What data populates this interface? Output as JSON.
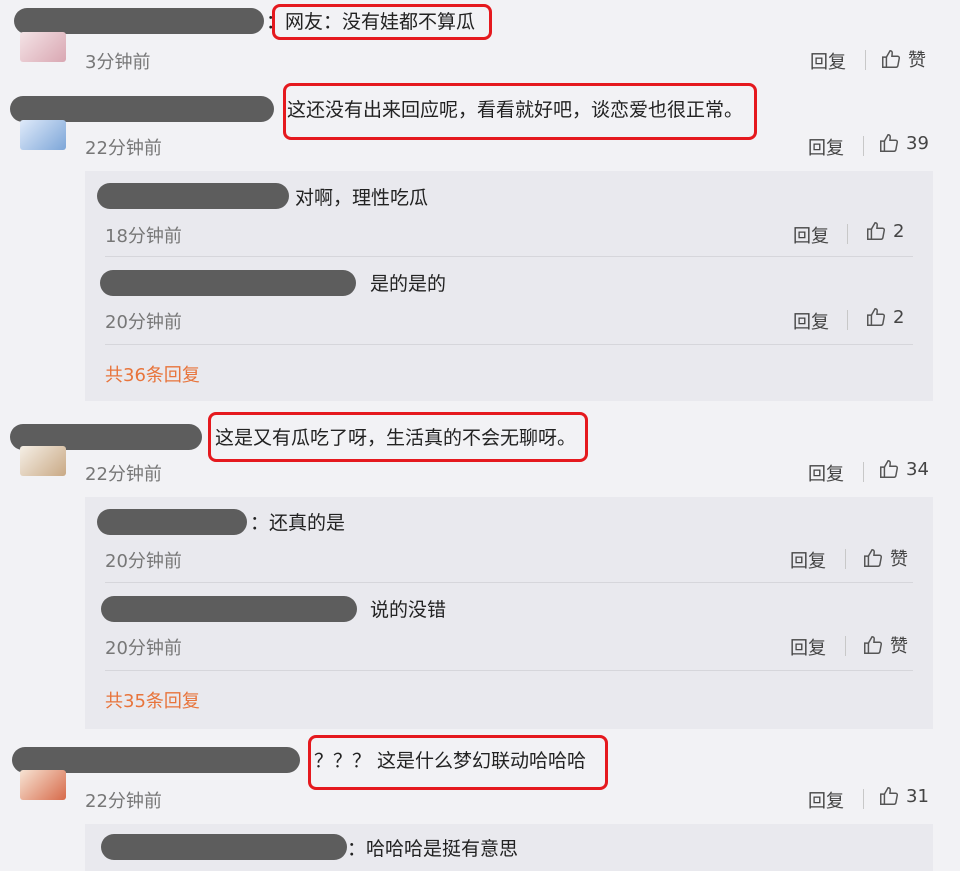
{
  "comments": [
    {
      "text": "：网友：没有娃都不算瓜",
      "time": "3分钟前",
      "reply_label": "回复",
      "like_label": "赞",
      "replies": []
    },
    {
      "text": "这还没有出来回应呢，看看就好吧，谈恋爱也很正常。",
      "time": "22分钟前",
      "reply_label": "回复",
      "like_label": "39",
      "replies": [
        {
          "text": "对啊，理性吃瓜",
          "time": "18分钟前",
          "reply_label": "回复",
          "like_label": "2"
        },
        {
          "text": "是的是的",
          "time": "20分钟前",
          "reply_label": "回复",
          "like_label": "2"
        }
      ],
      "more_replies": "共36条回复"
    },
    {
      "text": "这是又有瓜吃了呀，生活真的不会无聊呀。",
      "time": "22分钟前",
      "reply_label": "回复",
      "like_label": "34",
      "replies": [
        {
          "text": "：还真的是",
          "time": "20分钟前",
          "reply_label": "回复",
          "like_label": "赞"
        },
        {
          "text": "说的没错",
          "time": "20分钟前",
          "reply_label": "回复",
          "like_label": "赞"
        }
      ],
      "more_replies": "共35条回复"
    },
    {
      "text": "？？？ 这是什么梦幻联动哈哈哈",
      "time": "22分钟前",
      "reply_label": "回复",
      "like_label": "31",
      "replies": [
        {
          "text": "：哈哈哈是挺有意思"
        }
      ]
    }
  ],
  "colors": {
    "highlight_box": "#e5191e",
    "more_link": "#e8743b",
    "background": "#f2f2f5",
    "reply_panel": "#e9e9ee"
  },
  "icons": {
    "like": "thumbs-up-icon"
  }
}
